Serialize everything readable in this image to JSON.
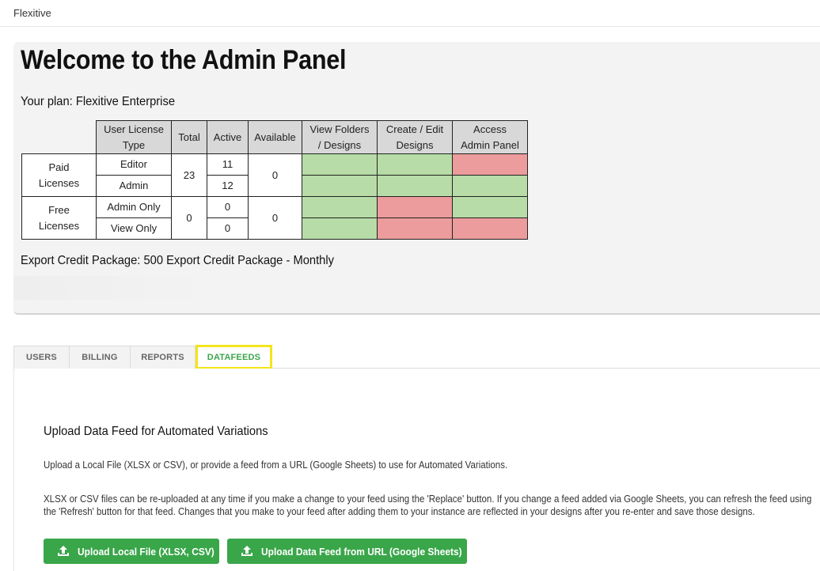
{
  "app": {
    "brand": "Flexitive"
  },
  "panel": {
    "title": "Welcome to the Admin Panel",
    "plan": "Your plan: Flexitive Enterprise",
    "export_credit": "Export Credit Package: 500 Export Credit Package - Monthly"
  },
  "license_table": {
    "headers": {
      "type": [
        "User License",
        "Type"
      ],
      "total": "Total",
      "active": "Active",
      "available": "Available",
      "view": [
        "View Folders",
        "/ Designs"
      ],
      "create": [
        "Create / Edit",
        "Designs"
      ],
      "access": [
        "Access",
        "Admin Panel"
      ]
    },
    "groups": [
      {
        "label": [
          "Paid",
          "Licenses"
        ],
        "total": "23",
        "available": "0",
        "rows": [
          {
            "type": "Editor",
            "active": "11",
            "view": "yes",
            "create": "yes",
            "access": "no"
          },
          {
            "type": "Admin",
            "active": "12",
            "view": "yes",
            "create": "yes",
            "access": "yes"
          }
        ]
      },
      {
        "label": [
          "Free",
          "Licenses"
        ],
        "total": "0",
        "available": "0",
        "rows": [
          {
            "type": "Admin Only",
            "active": "0",
            "view": "yes",
            "create": "no",
            "access": "yes"
          },
          {
            "type": "View Only",
            "active": "0",
            "view": "yes",
            "create": "no",
            "access": "no"
          }
        ]
      }
    ],
    "colors": {
      "yes": "#b7dca7",
      "no": "#ec9c9c"
    }
  },
  "tabs": {
    "items": [
      {
        "label": "USERS"
      },
      {
        "label": "BILLING"
      },
      {
        "label": "REPORTS"
      },
      {
        "label": "DATAFEEDS"
      }
    ],
    "active": "DATAFEEDS"
  },
  "datafeeds": {
    "title": "Upload Data Feed for Automated Variations",
    "intro": "Upload a Local File (XLSX or CSV), or provide a feed from a URL (Google Sheets) to use for Automated Variations.",
    "detail": "XLSX or CSV files can be re-uploaded at any time if you make a change to your feed using the 'Replace' button. If you change a feed added via Google Sheets, you can refresh the feed using the 'Refresh' button for that feed. Changes that you make to your feed after adding them to your instance are reflected in your designs after you re-enter and save those designs.",
    "buttons": {
      "upload_local": "Upload Local File (XLSX, CSV)",
      "upload_url": "Upload Data Feed from URL (Google Sheets)",
      "icon": "upload-icon"
    },
    "accent": "#3aa64a"
  }
}
